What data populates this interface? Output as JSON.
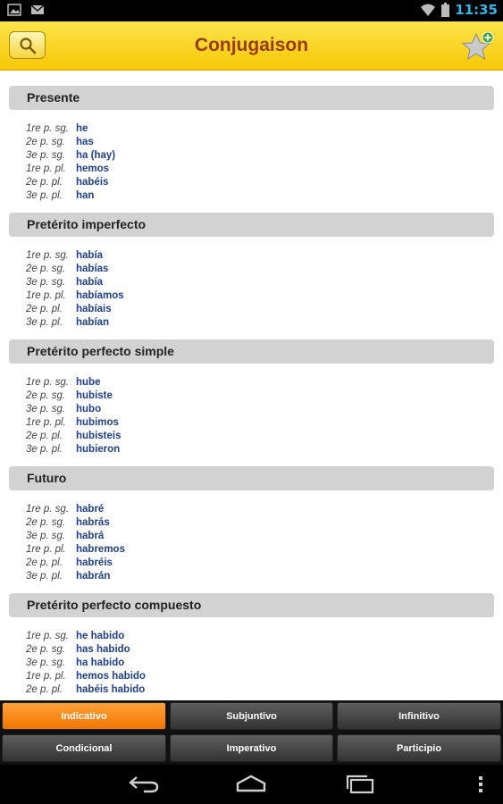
{
  "status_bar": {
    "time": "11:35",
    "left_icons": [
      "image-notification-icon",
      "gmail-notification-icon"
    ],
    "right_icons": [
      "wifi-icon",
      "battery-icon"
    ]
  },
  "action_bar": {
    "title": "Conjugaison",
    "search_icon": "search-icon",
    "favorite_icon": "star-add-icon",
    "bg_color": "#f9d21c",
    "title_color": "#9a3a10"
  },
  "sections": [
    {
      "title": "Presente",
      "rows": [
        {
          "person": "1re p. sg.",
          "form": "he"
        },
        {
          "person": "2e p. sg.",
          "form": "has"
        },
        {
          "person": "3e p. sg.",
          "form": "ha (hay)"
        },
        {
          "person": "1re p. pl.",
          "form": "hemos"
        },
        {
          "person": "2e p. pl.",
          "form": "habéis"
        },
        {
          "person": "3e p. pl.",
          "form": "han"
        }
      ]
    },
    {
      "title": "Pretérito imperfecto",
      "rows": [
        {
          "person": "1re p. sg.",
          "form": "había"
        },
        {
          "person": "2e p. sg.",
          "form": "habías"
        },
        {
          "person": "3e p. sg.",
          "form": "había"
        },
        {
          "person": "1re p. pl.",
          "form": "habíamos"
        },
        {
          "person": "2e p. pl.",
          "form": "habíais"
        },
        {
          "person": "3e p. pl.",
          "form": "habían"
        }
      ]
    },
    {
      "title": "Pretérito perfecto simple",
      "rows": [
        {
          "person": "1re p. sg.",
          "form": "hube"
        },
        {
          "person": "2e p. sg.",
          "form": "hubiste"
        },
        {
          "person": "3e p. sg.",
          "form": "hubo"
        },
        {
          "person": "1re p. pl.",
          "form": "hubimos"
        },
        {
          "person": "2e p. pl.",
          "form": "hubisteis"
        },
        {
          "person": "3e p. pl.",
          "form": "hubieron"
        }
      ]
    },
    {
      "title": "Futuro",
      "rows": [
        {
          "person": "1re p. sg.",
          "form": "habré"
        },
        {
          "person": "2e p. sg.",
          "form": "habrás"
        },
        {
          "person": "3e p. sg.",
          "form": "habrá"
        },
        {
          "person": "1re p. pl.",
          "form": "habremos"
        },
        {
          "person": "2e p. pl.",
          "form": "habréis"
        },
        {
          "person": "3e p. pl.",
          "form": "habrán"
        }
      ]
    },
    {
      "title": "Pretérito perfecto compuesto",
      "rows": [
        {
          "person": "1re p. sg.",
          "form": "he habido"
        },
        {
          "person": "2e p. sg.",
          "form": "has habido"
        },
        {
          "person": "3e p. sg.",
          "form": "ha habido"
        },
        {
          "person": "1re p. pl.",
          "form": "hemos habido"
        },
        {
          "person": "2e p. pl.",
          "form": "habéis habido"
        }
      ]
    }
  ],
  "tabs": {
    "row1": [
      "Indicativo",
      "Subjuntivo",
      "Infinitivo"
    ],
    "row2": [
      "Condicional",
      "Imperativo",
      "Participio"
    ],
    "active": "Indicativo",
    "active_color": "#f58a1a"
  },
  "nav_bar": {
    "icons": [
      "back-icon",
      "home-icon",
      "recent-apps-icon",
      "overflow-menu-icon"
    ]
  }
}
